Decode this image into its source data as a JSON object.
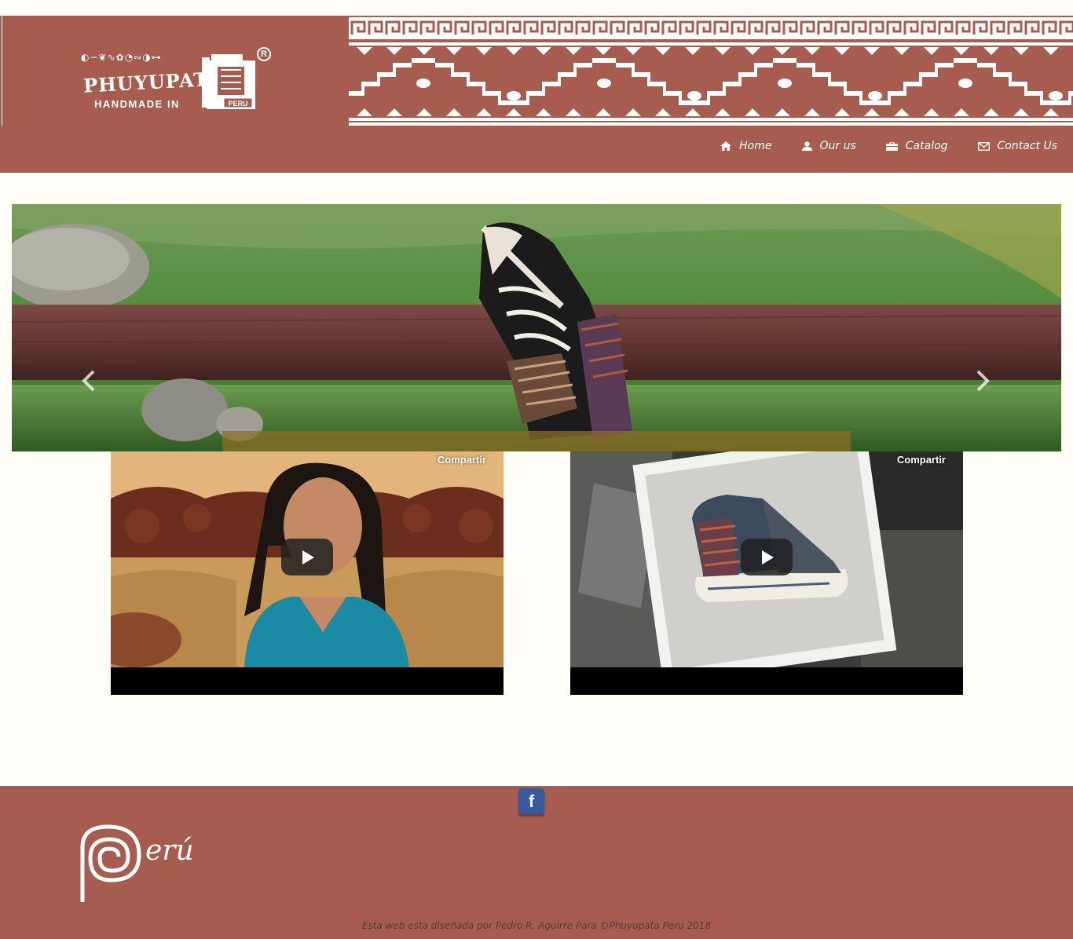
{
  "brand": {
    "name": "PHUYUPATA",
    "tagline": "HANDMADE IN",
    "badge": "PERU",
    "registered": "R",
    "color": "#a65d4f"
  },
  "nav": [
    {
      "label": "Home",
      "icon": "home-icon"
    },
    {
      "label": "Our us",
      "icon": "user-icon"
    },
    {
      "label": "Catalog",
      "icon": "briefcase-icon"
    },
    {
      "label": "Contact Us",
      "icon": "envelope-icon"
    }
  ],
  "carousel": {
    "prev_icon": "chevron-left-icon",
    "next_icon": "chevron-right-icon"
  },
  "videos": [
    {
      "share_label": "Compartir",
      "play_icon": "play-icon"
    },
    {
      "share_label": "Compartir",
      "play_icon": "play-icon"
    }
  ],
  "footer": {
    "social_icon": "facebook-icon",
    "social_glyph": "f",
    "country_logo_text": "erú",
    "credits": "Esta web esta diseñada por Pedro R. Aguirre Para ©Phuyupata Peru 2018"
  }
}
